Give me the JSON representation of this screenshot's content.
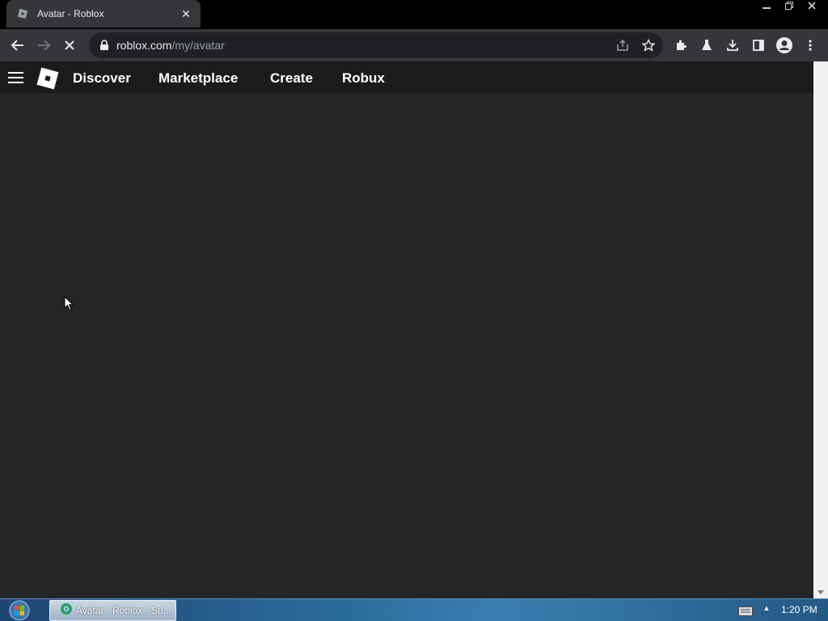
{
  "browser": {
    "tab_title": "Avatar - Roblox",
    "tab_close": "✕",
    "url_host": "roblox.com",
    "url_path": "/my/avatar",
    "window_controls": [
      "minimize",
      "restore",
      "close"
    ]
  },
  "site": {
    "nav_links": [
      "Discover",
      "Marketplace",
      "Create",
      "Robux"
    ]
  },
  "taskbar": {
    "task_label": "Avatar - Roblox - Su...",
    "clock": "1:20 PM",
    "tray_arrow": "▲"
  },
  "icons": {
    "toolbar_left": [
      "back-icon",
      "forward-icon",
      "loading-icon"
    ],
    "toolbar_right": [
      "share-icon",
      "star-icon",
      "extensions-icon",
      "labs-icon",
      "download-icon",
      "sidepanel-icon",
      "profile-icon",
      "menu-icon"
    ]
  },
  "colors": {
    "page_bg": "#232527",
    "nav_bg": "#191b1d",
    "chrome_bg": "#35363a"
  }
}
